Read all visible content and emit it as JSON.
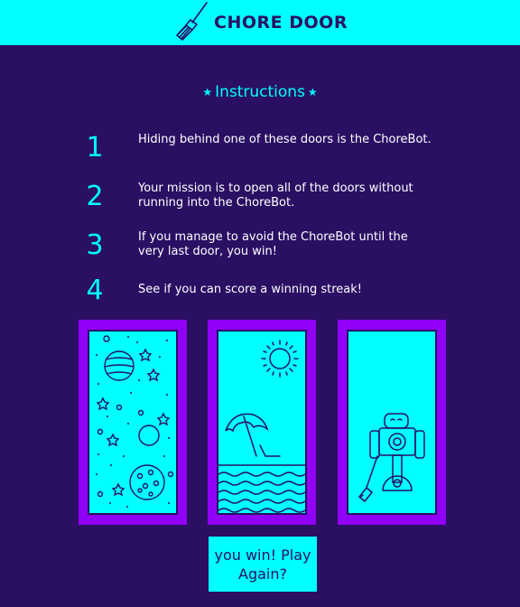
{
  "header": {
    "title": "CHORE DOOR",
    "logo_icon": "broom-icon"
  },
  "instructions": {
    "title": "Instructions",
    "steps": [
      {
        "number": "1",
        "text": "Hiding behind one of these doors is the ChoreBot."
      },
      {
        "number": "2",
        "text": "Your mission is to open all of the doors without running into the ChoreBot."
      },
      {
        "number": "3",
        "text": "If you manage to avoid the ChoreBot until the very last door, you win!"
      },
      {
        "number": "4",
        "text": "See if you can score a winning streak!"
      }
    ]
  },
  "doors": [
    {
      "content": "space"
    },
    {
      "content": "beach"
    },
    {
      "content": "chorebot"
    }
  ],
  "play_button": {
    "label": "you win! Play Again?"
  },
  "colors": {
    "background": "#2a0f63",
    "accent": "#00ffff",
    "door_frame": "#9000f7"
  }
}
